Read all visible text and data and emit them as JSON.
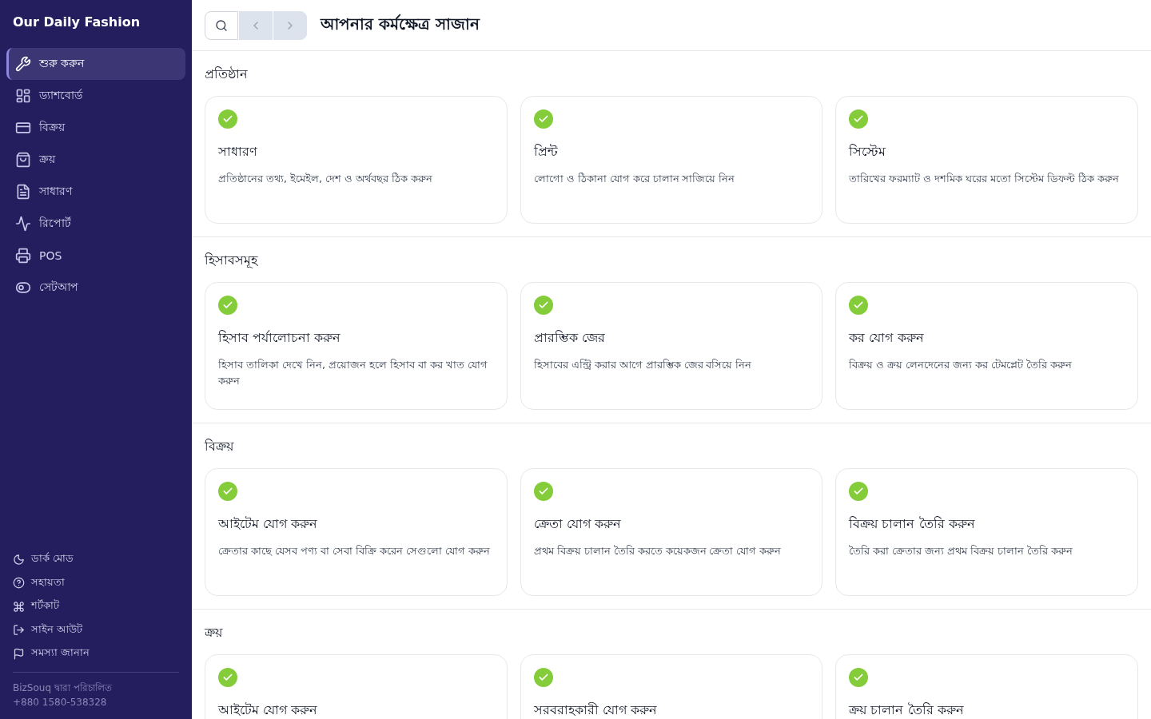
{
  "sidebar": {
    "brand": "Our Daily Fashion",
    "items": [
      {
        "label": "শুরু করুন",
        "selected": true
      },
      {
        "label": "ড্যাশবোর্ড",
        "selected": false
      },
      {
        "label": "বিক্রয়",
        "selected": false
      },
      {
        "label": "ক্রয়",
        "selected": false
      },
      {
        "label": "সাধারণ",
        "selected": false
      },
      {
        "label": "রিপোর্ট",
        "selected": false
      },
      {
        "label": "POS",
        "selected": false
      },
      {
        "label": "সেটআপ",
        "selected": false
      }
    ],
    "footer_links": [
      "ডার্ক মোড",
      "সহায়তা",
      "শর্টকাট",
      "সাইন আউট",
      "সমস্যা জানান"
    ],
    "powered_by": "BizSouq দ্বারা পরিচালিত",
    "phone": "+880 1580-538328"
  },
  "header": {
    "title": "আপনার কর্মক্ষেত্র সাজান"
  },
  "sections": [
    {
      "title": "প্রতিষ্ঠান",
      "cards": [
        {
          "done": true,
          "title": "সাধারণ",
          "description": "প্রতিষ্ঠানের তথ্য, ইমেইল, দেশ ও অর্থবছর ঠিক করুন"
        },
        {
          "done": true,
          "title": "প্রিন্ট",
          "description": "লোগো ও ঠিকানা যোগ করে চালান সাজিয়ে নিন"
        },
        {
          "done": true,
          "title": "সিস্টেম",
          "description": "তারিখের ফরম্যাট ও দশমিক ঘরের মতো সিস্টেম ডিফল্ট ঠিক করুন"
        }
      ]
    },
    {
      "title": "হিসাবসমূহ",
      "cards": [
        {
          "done": true,
          "title": "হিসাব পর্যালোচনা করুন",
          "description": "হিসাব তালিকা দেখে নিন, প্রয়োজন হলে হিসাব বা কর খাত যোগ করুন"
        },
        {
          "done": true,
          "title": "প্রারম্ভিক জের",
          "description": "হিসাবের এন্ট্রি করার আগে প্রারম্ভিক জের বসিয়ে নিন"
        },
        {
          "done": true,
          "title": "কর যোগ করুন",
          "description": "বিক্রয় ও ক্রয় লেনদেনের জন্য কর টেমপ্লেট তৈরি করুন"
        }
      ]
    },
    {
      "title": "বিক্রয়",
      "cards": [
        {
          "done": true,
          "title": "আইটেম যোগ করুন",
          "description": "ক্রেতার কাছে যেসব পণ্য বা সেবা বিক্রি করেন সেগুলো যোগ করুন"
        },
        {
          "done": true,
          "title": "ক্রেতা যোগ করুন",
          "description": "প্রথম বিক্রয় চালান তৈরি করতে কয়েকজন ক্রেতা যোগ করুন"
        },
        {
          "done": true,
          "title": "বিক্রয় চালান তৈরি করুন",
          "description": "তৈরি করা ক্রেতার জন্য প্রথম বিক্রয় চালান তৈরি করুন"
        }
      ]
    },
    {
      "title": "ক্রয়",
      "cards": [
        {
          "done": true,
          "title": "আইটেম যোগ করুন"
        },
        {
          "done": true,
          "title": "সরবরাহকারী যোগ করুন"
        },
        {
          "done": true,
          "title": "ক্রয় চালান তৈরি করুন"
        }
      ]
    }
  ]
}
